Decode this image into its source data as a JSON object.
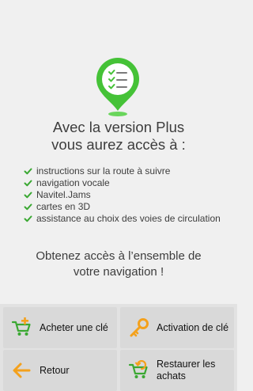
{
  "promo": {
    "headline_line1": "Avec la version Plus",
    "headline_line2": "vous aurez accès à :",
    "features": [
      "instructions sur la route à suivre",
      "navigation vocale",
      "Navitel.Jams",
      "cartes en 3D",
      "assistance au choix des voies de circulation"
    ],
    "cta_line1": "Obtenez accès à l’ensemble de",
    "cta_line2": "votre navigation !"
  },
  "buttons": {
    "buy_label": "Acheter une clé",
    "activate_label": "Activation de clé",
    "back_label": "Retour",
    "restore_label": "Restaurer les achats"
  },
  "colors": {
    "accent_green": "#3dbb2e",
    "check_green": "#3aa832",
    "arrow_orange": "#f4a11c",
    "background": "#f0f0f0",
    "button_bg": "#d9d9d9"
  },
  "icons": {
    "hero": "checklist-pin-icon",
    "feature": "checkmark-icon",
    "buy": "cart-add-icon",
    "activate": "key-icon",
    "back": "arrow-left-icon",
    "restore": "cart-restore-icon"
  }
}
